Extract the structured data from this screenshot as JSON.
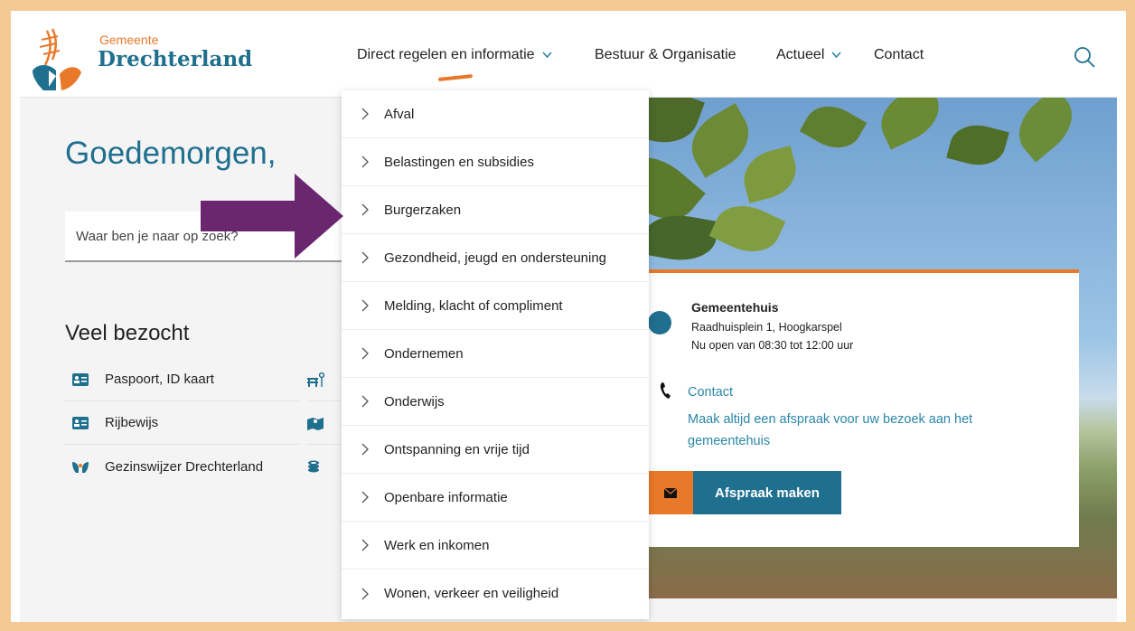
{
  "header": {
    "logo_small": "Gemeente",
    "logo_big": "Drechterland",
    "nav": [
      {
        "label": "Direct regelen en informatie",
        "has_chevron": true
      },
      {
        "label": "Bestuur & Organisatie",
        "has_chevron": false
      },
      {
        "label": "Actueel",
        "has_chevron": true
      },
      {
        "label": "Contact",
        "has_chevron": false
      }
    ],
    "search_icon": "search-icon"
  },
  "main": {
    "greeting": "Goedemorgen,",
    "search_placeholder": "Waar ben je naar op zoek?",
    "veel_bezocht_title": "Veel bezocht",
    "visited": [
      {
        "label": "Paspoort, ID kaart",
        "icon": "id-card-icon"
      },
      {
        "label": "Rijbewijs",
        "icon": "id-card-icon"
      },
      {
        "label": "Gezinswijzer Drechterland",
        "icon": "family-icon"
      }
    ],
    "visited_right_icons": [
      "bench-icon",
      "map-icon",
      "coins-icon"
    ]
  },
  "dropdown": {
    "items": [
      "Afval",
      "Belastingen en subsidies",
      "Burgerzaken",
      "Gezondheid, jeugd en ondersteuning",
      "Melding, klacht of compliment",
      "Ondernemen",
      "Onderwijs",
      "Ontspanning en vrije tijd",
      "Openbare informatie",
      "Werk en inkomen",
      "Wonen, verkeer en veiligheid"
    ]
  },
  "card": {
    "title": "Gemeentehuis",
    "address": "Raadhuisplein 1, Hoogkarspel",
    "open": "Nu open van 08:30 tot 12:00 uur",
    "contact_link": "Contact",
    "note": "Maak altijd een afspraak voor uw bezoek aan het gemeentehuis",
    "button": "Afspraak maken"
  },
  "colors": {
    "brand_blue": "#1f6f8e",
    "brand_orange": "#e8792a",
    "link": "#2a86a8",
    "arrow": "#6b2670",
    "frame": "#f5c993"
  }
}
